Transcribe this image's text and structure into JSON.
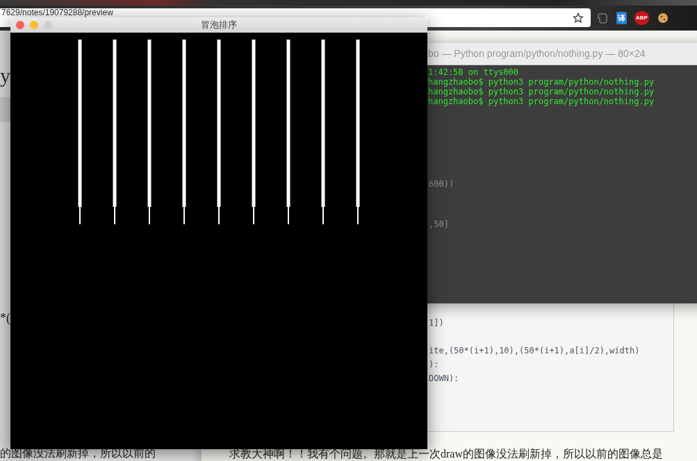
{
  "browser": {
    "address": "7629/notes/19079288/preview",
    "extensions": [
      {
        "kind": "elephant"
      },
      {
        "kind": "text",
        "label": "译",
        "color": "#2a7fd4"
      },
      {
        "kind": "text",
        "label": "ABP",
        "color": "#c4161c"
      },
      {
        "kind": "cookie"
      }
    ],
    "sidebar": {
      "heading": "y",
      "code_fragment": "*(",
      "text": "的图像没法刷新掉，所以以前的"
    },
    "code_lines": [
      "1])",
      "ite,(50*(i+1),10),(50*(i+1),a[i]/2),width)",
      "):",
      "DOWN):"
    ],
    "paragraph": "求教大神啊！！我有个问题。那就是上一次draw的图像没法刷新掉，所以以前的图像总是"
  },
  "terminal": {
    "title": "bo — Python program/python/nothing.py — 80×24",
    "lines": [
      "1:42:58 on ttys000",
      "hangzhaobo$ python3 program/python/nothing.py",
      "hangzhaobo$ python3 program/python/nothing.py",
      "hangzhaobo$ python3 program/python/nothing.py"
    ],
    "behind_lines": [
      "600))",
      ",50]"
    ]
  },
  "game_window": {
    "title": "冒泡排序"
  }
}
